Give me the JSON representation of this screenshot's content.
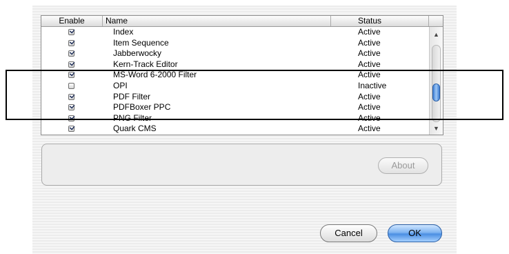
{
  "table": {
    "headers": {
      "enable": "Enable",
      "name": "Name",
      "status": "Status"
    },
    "rows": [
      {
        "enabled": true,
        "name": "Index",
        "status": "Active"
      },
      {
        "enabled": true,
        "name": "Item Sequence",
        "status": "Active"
      },
      {
        "enabled": true,
        "name": "Jabberwocky",
        "status": "Active"
      },
      {
        "enabled": true,
        "name": "Kern-Track Editor",
        "status": "Active"
      },
      {
        "enabled": true,
        "name": "MS-Word 6-2000 Filter",
        "status": "Active"
      },
      {
        "enabled": false,
        "name": "OPI",
        "status": "Inactive"
      },
      {
        "enabled": true,
        "name": "PDF Filter",
        "status": "Active"
      },
      {
        "enabled": true,
        "name": "PDFBoxer PPC",
        "status": "Active"
      },
      {
        "enabled": true,
        "name": "PNG Filter",
        "status": "Active"
      },
      {
        "enabled": true,
        "name": "Quark CMS",
        "status": "Active"
      }
    ]
  },
  "scrollbar": {
    "up_icon": "arrow-up-icon",
    "down_icon": "arrow-down-icon",
    "up_glyph": "▲",
    "down_glyph": "▼"
  },
  "buttons": {
    "about": "About",
    "cancel": "Cancel",
    "ok": "OK"
  }
}
